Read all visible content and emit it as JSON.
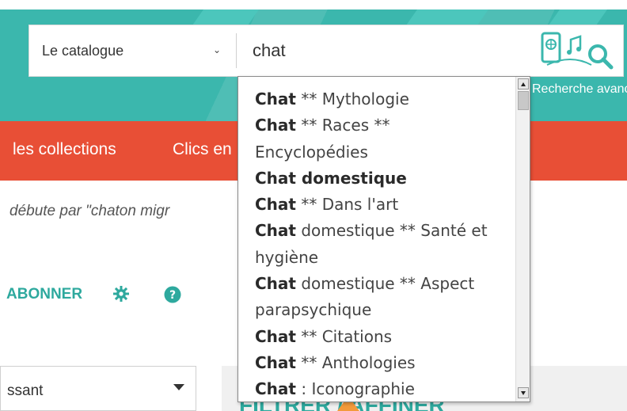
{
  "search": {
    "scope_label": "Le catalogue",
    "query": "chat",
    "advanced_label": "Recherche avancée"
  },
  "nav": {
    "items": [
      "les collections",
      "Clics en"
    ]
  },
  "results": {
    "note": "débute par \"chaton migr"
  },
  "toolbar": {
    "subscribe_label": "ABONNER"
  },
  "sort": {
    "selected": "ssant"
  },
  "filters": {
    "heading": "FILTRER / AFFINER"
  },
  "suggestions": [
    {
      "bold": "Chat",
      "rest": " ** Mythologie"
    },
    {
      "bold": "Chat",
      "rest": " ** Races ** Encyclopédies"
    },
    {
      "bold": "Chat domestique",
      "rest": ""
    },
    {
      "bold": "Chat",
      "rest": " ** Dans l'art"
    },
    {
      "bold": "Chat",
      "rest": " domestique ** Santé et hygiène"
    },
    {
      "bold": "Chat",
      "rest": " domestique ** Aspect parapsychique"
    },
    {
      "bold": "Chat",
      "rest": " ** Citations"
    },
    {
      "bold": "Chat",
      "rest": " ** Anthologies"
    },
    {
      "bold": "Chat",
      "rest": " : Iconographie"
    }
  ],
  "colors": {
    "teal": "#3bb7ad",
    "orange_nav": "#e84f36",
    "accent_text": "#2ea99e",
    "arrow": "#f39a3b"
  }
}
